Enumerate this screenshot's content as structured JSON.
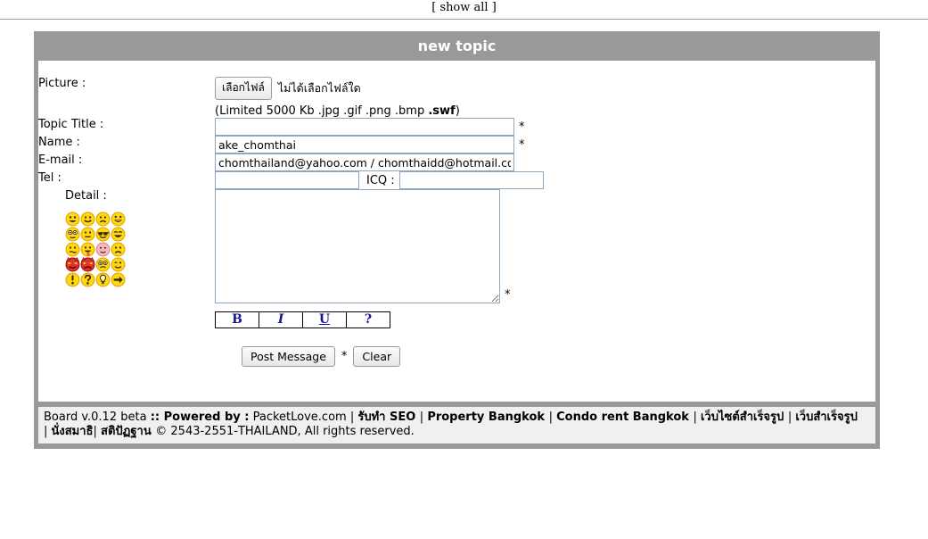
{
  "topbar": {
    "show_all": "[ show all ]"
  },
  "window": {
    "title": "new topic"
  },
  "form": {
    "picture": {
      "label": "Picture :",
      "button_label": "เลือกไฟล์",
      "file_status": "ไม่ได้เลือกไฟล์ใด",
      "limit_note_prefix": "(Limited 5000 Kb .jpg .gif .png .bmp ",
      "limit_note_bold": ".swf",
      "limit_note_suffix": ")"
    },
    "topic_title": {
      "label": "Topic Title :",
      "value": "",
      "required_marker": "*"
    },
    "name": {
      "label": "Name :",
      "value": "ake_chomthai",
      "required_marker": "*"
    },
    "email": {
      "label": "E-mail :",
      "value": "chomthailand@yahoo.com / chomthaidd@hotmail.com"
    },
    "tel": {
      "label": "Tel :",
      "value": ""
    },
    "icq": {
      "label": "ICQ :",
      "value": ""
    },
    "detail": {
      "label": "Detail :",
      "value": "",
      "required_marker": "*"
    },
    "bbcode": [
      {
        "name": "bold",
        "label": "B"
      },
      {
        "name": "italic",
        "label": "I"
      },
      {
        "name": "underline",
        "label": "U"
      },
      {
        "name": "help",
        "label": "?"
      }
    ],
    "smilies": [
      {
        "name": "smiley-grin-icon",
        "title": "grin"
      },
      {
        "name": "smiley-happy-icon",
        "title": "happy"
      },
      {
        "name": "smiley-sad-icon",
        "title": "sad"
      },
      {
        "name": "smiley-biggrin-icon",
        "title": "big grin"
      },
      {
        "name": "smiley-shocked-icon",
        "title": "shocked"
      },
      {
        "name": "smiley-neutral-icon",
        "title": "neutral"
      },
      {
        "name": "smiley-cool-icon",
        "title": "cool"
      },
      {
        "name": "smiley-laugh-icon",
        "title": "laugh"
      },
      {
        "name": "smiley-confused-icon",
        "title": "confused"
      },
      {
        "name": "smiley-tongue-icon",
        "title": "tongue"
      },
      {
        "name": "smiley-blush-icon",
        "title": "blush"
      },
      {
        "name": "smiley-frown-icon",
        "title": "frown"
      },
      {
        "name": "smiley-devil-icon",
        "title": "devil"
      },
      {
        "name": "smiley-angry-devil-icon",
        "title": "angry devil"
      },
      {
        "name": "smiley-cry-icon",
        "title": "cry"
      },
      {
        "name": "smiley-wink-icon",
        "title": "wink"
      },
      {
        "name": "exclamation-icon",
        "title": "exclamation"
      },
      {
        "name": "question-icon",
        "title": "question"
      },
      {
        "name": "idea-icon",
        "title": "idea"
      },
      {
        "name": "arrow-icon",
        "title": "arrow"
      }
    ],
    "post_button": "Post Message",
    "post_required_marker": "*",
    "clear_button": "Clear"
  },
  "footer": {
    "board_version": "Board v.0.12 beta ",
    "powered_by_label": ":: Powered by :",
    "powered_by_site": " PacketLove.com ",
    "sep": "| ",
    "link_seo": "รับทำ SEO ",
    "link_property": "Property Bangkok ",
    "link_condo": "Condo rent Bangkok ",
    "link_website_ready": "เว็บไซต์สำเร็จรูป ",
    "link_web_ready": "เว็บสำเร็จรูป",
    "line2_sep1": "| ",
    "link_meditation": "นั่งสมาธิ",
    "line2_sep2": "| ",
    "link_satipatthana": "สติปัฏฐาน ",
    "copyright": "© 2543-2551-THAILAND, All rights reserved."
  },
  "colors": {
    "frame_gray": "#999999",
    "panel_white": "#ffffff",
    "footer_bg": "#f0f0f0",
    "input_border": "#8fa8c0",
    "bbcode_text": "#16168c"
  }
}
